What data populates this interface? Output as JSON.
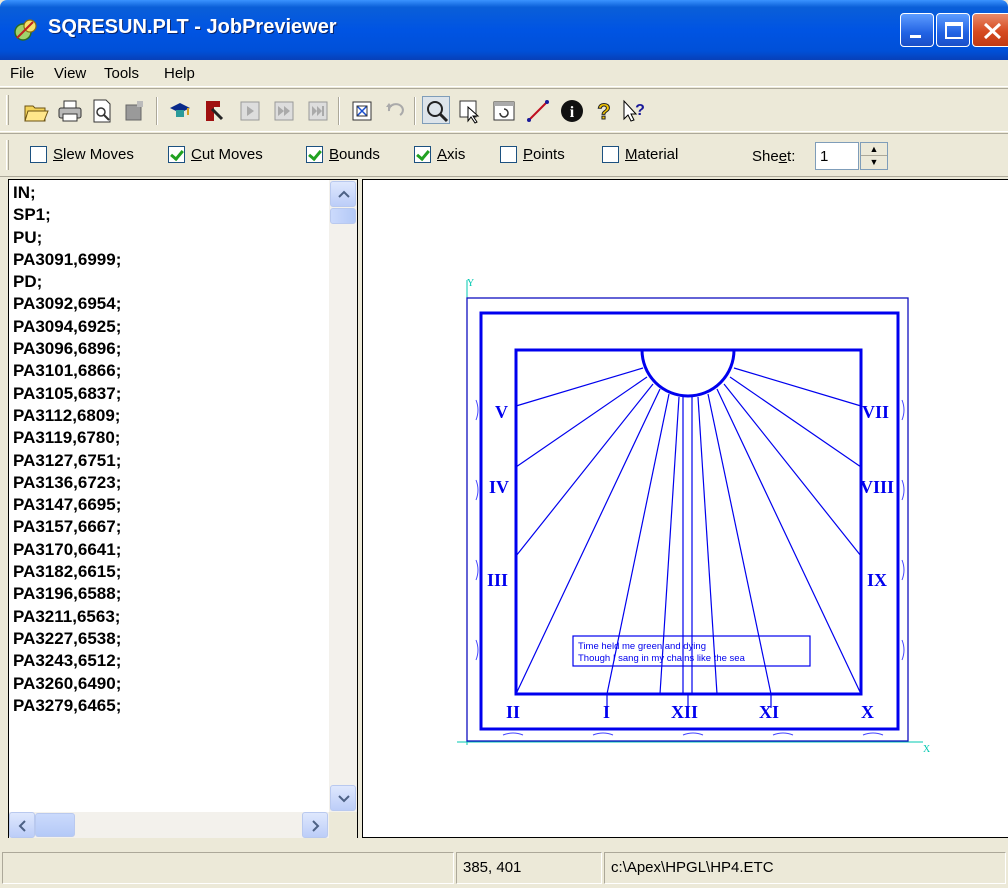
{
  "window": {
    "title": "SQRESUN.PLT - JobPreviewer"
  },
  "menu": {
    "items": [
      "File",
      "View",
      "Tools",
      "Help"
    ]
  },
  "toolbar": {
    "icons": [
      "open-icon",
      "print-icon",
      "print-preview-icon",
      "stop-icon",
      "cut-job-icon",
      "plotter-icon",
      "step-icon",
      "fast-forward-icon",
      "skip-end-icon",
      "zoom-fit-icon",
      "undo-icon",
      "zoom-icon",
      "select-icon",
      "refresh-icon",
      "line-tool-icon",
      "info-icon",
      "help-icon",
      "context-help-icon"
    ]
  },
  "options": {
    "slew_moves": {
      "pre": "",
      "mn": "S",
      "post": "lew Moves",
      "checked": false
    },
    "cut_moves": {
      "pre": "",
      "mn": "C",
      "post": "ut Moves",
      "checked": true
    },
    "bounds": {
      "pre": "",
      "mn": "B",
      "post": "ounds",
      "checked": true
    },
    "axis": {
      "pre": "",
      "mn": "A",
      "post": "xis",
      "checked": true
    },
    "points": {
      "pre": "",
      "mn": "P",
      "post": "oints",
      "checked": false
    },
    "material": {
      "pre": "",
      "mn": "M",
      "post": "aterial",
      "checked": false
    },
    "sheet_label_pre": "She",
    "sheet_label_mn": "e",
    "sheet_label_post": "t:",
    "sheet_value": "1"
  },
  "code_lines": [
    "IN;",
    "SP1;",
    "PU;",
    "PA3091,6999;",
    "PD;",
    "PA3092,6954;",
    "PA3094,6925;",
    "PA3096,6896;",
    "PA3101,6866;",
    "PA3105,6837;",
    "PA3112,6809;",
    "PA3119,6780;",
    "PA3127,6751;",
    "PA3136,6723;",
    "PA3147,6695;",
    "PA3157,6667;",
    "PA3170,6641;",
    "PA3182,6615;",
    "PA3196,6588;",
    "PA3211,6563;",
    "PA3227,6538;",
    "PA3243,6512;",
    "PA3260,6490;",
    "PA3279,6465;"
  ],
  "plot": {
    "axis_y_label": "Y",
    "axis_x_label": "X",
    "hour_labels": {
      "v": "V",
      "iv": "IV",
      "iii": "III",
      "ii": "II",
      "i": "I",
      "xii": "XII",
      "xi": "XI",
      "x": "X",
      "ix": "IX",
      "viii": "VIII",
      "vii": "VII"
    },
    "motto_line1": "Time held me green and dying",
    "motto_line2": "Though I sang in my chains like the sea",
    "colors": {
      "drawing": "#0000ee",
      "axis": "#00c8b0",
      "bounds": "#1010c0"
    }
  },
  "status": {
    "coords": "385, 401",
    "path": "c:\\Apex\\HPGL\\HP4.ETC"
  }
}
